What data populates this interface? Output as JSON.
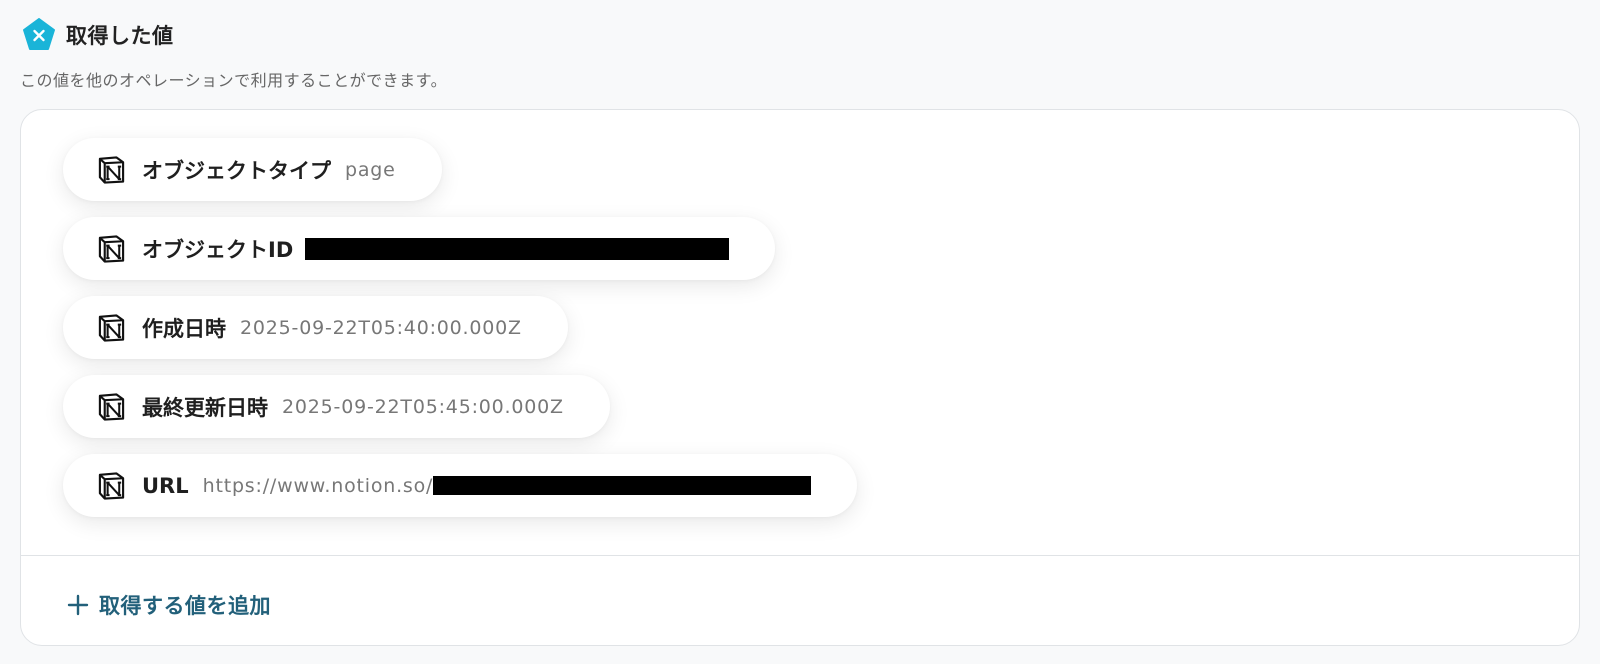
{
  "header": {
    "title": "取得した値",
    "icon": "close-icon",
    "icon_color": "#1ab4d8"
  },
  "description": "この値を他のオペレーションで利用することができます。",
  "fields": [
    {
      "icon": "notion-icon",
      "label": "オブジェクトタイプ",
      "value": "page"
    },
    {
      "icon": "notion-icon",
      "label": "オブジェクトID",
      "value": ""
    },
    {
      "icon": "notion-icon",
      "label": "作成日時",
      "value": "2025-09-22T05:40:00.000Z"
    },
    {
      "icon": "notion-icon",
      "label": "最終更新日時",
      "value": "2025-09-22T05:45:00.000Z"
    },
    {
      "icon": "notion-icon",
      "label": "URL",
      "value": "https://www.notion.so/"
    }
  ],
  "add_button": {
    "icon": "plus-icon",
    "label": "取得する値を追加",
    "color": "#22607a"
  }
}
